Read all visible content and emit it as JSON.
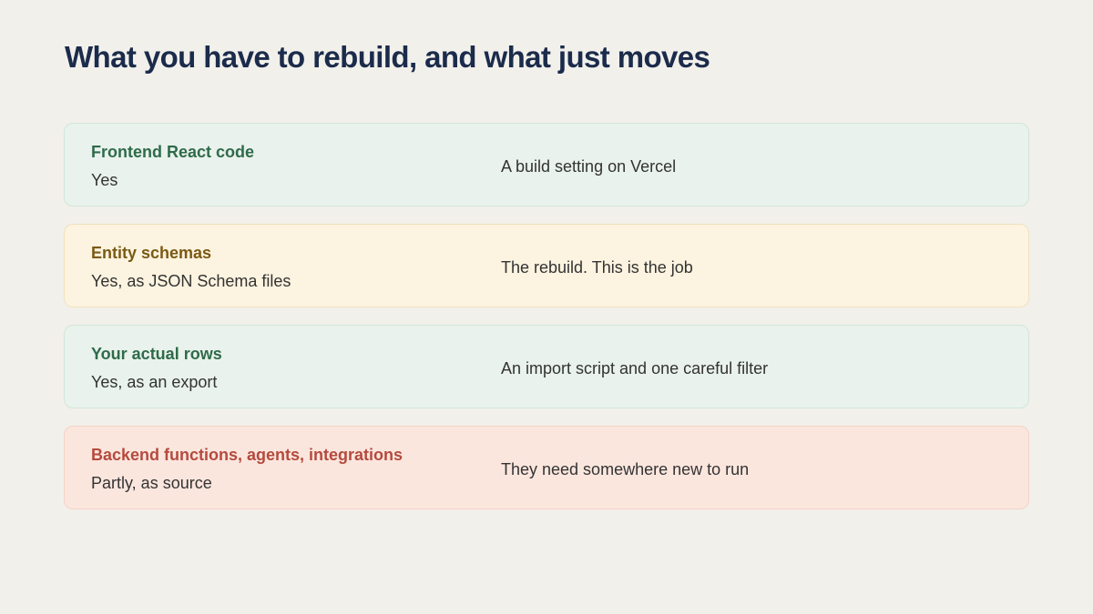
{
  "slide": {
    "title": "What you have to rebuild, and what just moves"
  },
  "rows": [
    {
      "heading": "Frontend React code",
      "answer": "Yes",
      "note": "A build setting on Vercel",
      "tone": "green"
    },
    {
      "heading": "Entity schemas",
      "answer": "Yes, as JSON Schema files",
      "note": "The rebuild. This is the job",
      "tone": "amber"
    },
    {
      "heading": "Your actual rows",
      "answer": "Yes, as an export",
      "note": "An import script and one careful filter",
      "tone": "green"
    },
    {
      "heading": "Backend functions, agents, integrations",
      "answer": "Partly, as source",
      "note": "They need somewhere new to run",
      "tone": "red"
    }
  ],
  "colors": {
    "background": "#f2f0eb",
    "title": "#1b2b4b",
    "green_heading": "#2f6b4a",
    "amber_heading": "#7a5a14",
    "red_heading": "#b54a3e",
    "green_fill": "#e9f2ec",
    "amber_fill": "#fcf3e0",
    "red_fill": "#fbe6de"
  }
}
